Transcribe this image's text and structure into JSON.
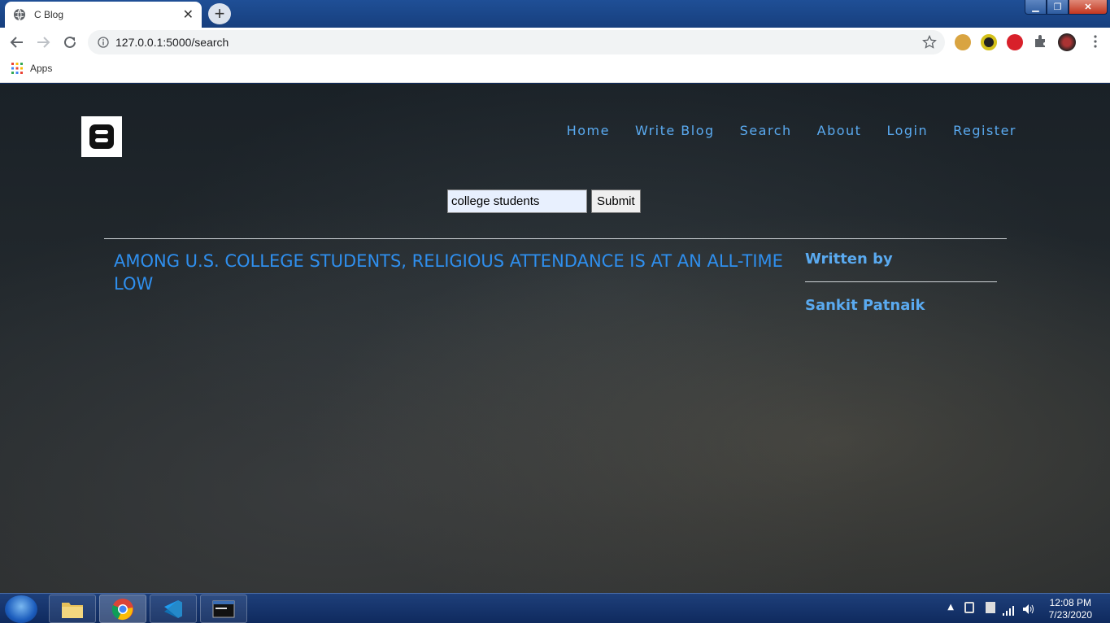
{
  "browser": {
    "tab_title": "C Blog",
    "url": "127.0.0.1:5000/search",
    "bookmarks_apps": "Apps"
  },
  "site": {
    "nav": [
      "Home",
      "Write Blog",
      "Search",
      "About",
      "Login",
      "Register"
    ]
  },
  "search": {
    "value": "college students",
    "submit_label": "Submit"
  },
  "result": {
    "title": "AMONG U.S. COLLEGE STUDENTS, RELIGIOUS ATTENDANCE IS AT AN ALL-TIME LOW",
    "written_by_label": "Written by",
    "author": "Sankit Patnaik"
  },
  "taskbar": {
    "time": "12:08 PM",
    "date": "7/23/2020"
  },
  "colors": {
    "link": "#2f8fee",
    "nav": "#5aaaf0"
  }
}
